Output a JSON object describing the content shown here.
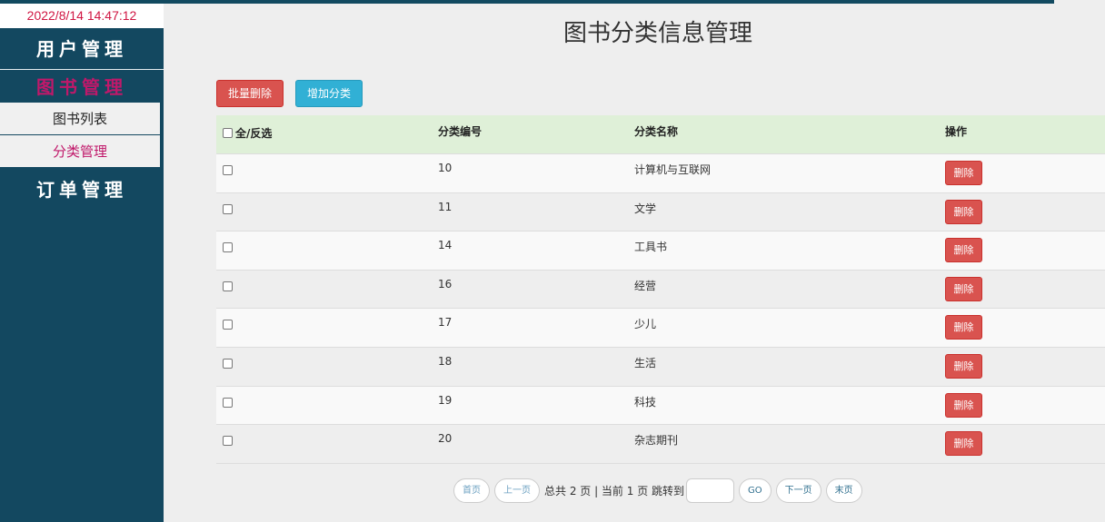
{
  "clock": "2022/8/14 14:47:12",
  "sidebar": {
    "user_mgmt": "用户管理",
    "book_mgmt": "图书管理",
    "book_list": "图书列表",
    "category_mgmt": "分类管理",
    "order_mgmt": "订单管理"
  },
  "page_title": "图书分类信息管理",
  "toolbar": {
    "batch_delete": "批量删除",
    "add_category": "增加分类"
  },
  "table": {
    "headers": {
      "select_all": "全/反选",
      "id": "分类编号",
      "name": "分类名称",
      "action": "操作"
    },
    "rows": [
      {
        "id": "10",
        "name": "计算机与互联网",
        "action": "删除"
      },
      {
        "id": "11",
        "name": "文学",
        "action": "删除"
      },
      {
        "id": "14",
        "name": "工具书",
        "action": "删除"
      },
      {
        "id": "16",
        "name": "经营",
        "action": "删除"
      },
      {
        "id": "17",
        "name": "少儿",
        "action": "删除"
      },
      {
        "id": "18",
        "name": "生活",
        "action": "删除"
      },
      {
        "id": "19",
        "name": "科技",
        "action": "删除"
      },
      {
        "id": "20",
        "name": "杂志期刊",
        "action": "删除"
      }
    ]
  },
  "pager": {
    "first": "首页",
    "prev": "上一页",
    "info": "总共 2 页 | 当前 1 页 跳转到",
    "go": "GO",
    "next": "下一页",
    "last": "末页",
    "jump_value": ""
  },
  "colors": {
    "sidebar_bg": "#134860",
    "active_nav": "#c0186a",
    "danger": "#d9534f",
    "info": "#31b0d5",
    "header_row": "#dff0d8"
  }
}
